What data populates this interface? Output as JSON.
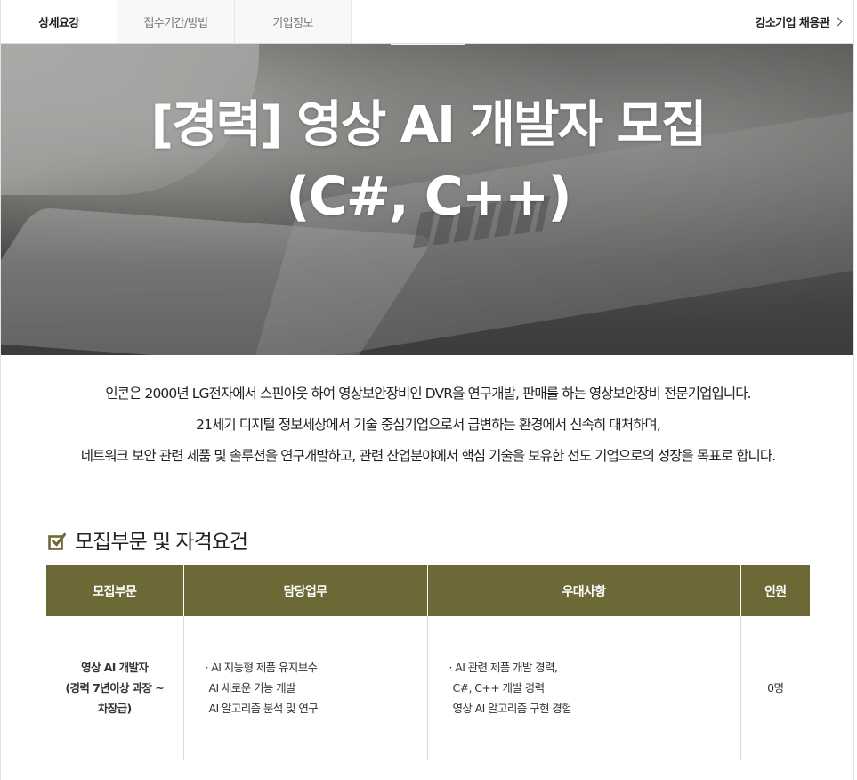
{
  "tabs": [
    {
      "label": "상세요강",
      "active": true
    },
    {
      "label": "접수기간/방법",
      "active": false
    },
    {
      "label": "기업정보",
      "active": false
    }
  ],
  "company_link": {
    "label": "강소기업 채용관"
  },
  "hero": {
    "title_line1": "[경력] 영상 AI 개발자 모집",
    "title_line2": "(C#, C++)"
  },
  "intro": {
    "lines": [
      "인콘은 2000년 LG전자에서 스핀아웃 하여 영상보안장비인 DVR을 연구개발, 판매를 하는 영상보안장비 전문기업입니다.",
      "21세기 디지털 정보세상에서 기술 중심기업으로서 급변하는 환경에서 신속히 대처하며,",
      "네트워크 보안 관련 제품 및 솔루션을 연구개발하고, 관련 산업분야에서 핵심 기술을 보유한 선도 기업으로의 성장을 목표로 합니다."
    ]
  },
  "section": {
    "title": "모집부문 및 자격요건",
    "icon": "edit-check-icon"
  },
  "table": {
    "headers": [
      "모집부문",
      "담당업무",
      "우대사항",
      "인원"
    ],
    "rows": [
      {
        "position": [
          "영상 AI 개발자",
          "(경력 7년이상 과장 ~",
          "차장급)"
        ],
        "duties": [
          "· AI 지능형 제품 유지보수",
          "AI 새로운 기능 개발",
          "AI 알고리즘 분석 및 연구"
        ],
        "preferred": [
          "· AI 관련 제품 개발 경력,",
          "C#, C++ 개발 경력",
          "영상  AI 알고리즘 구현 경험"
        ],
        "headcount": "0명"
      }
    ]
  },
  "colors": {
    "accent": "#6c6936",
    "text": "#222222",
    "tab_inactive_bg": "#f8f8f8"
  }
}
